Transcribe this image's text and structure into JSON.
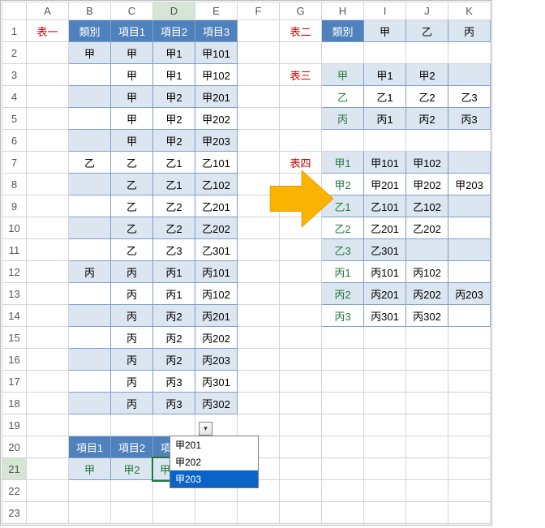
{
  "columns": [
    "A",
    "B",
    "C",
    "D",
    "E",
    "F",
    "G",
    "H",
    "I",
    "J",
    "K"
  ],
  "selectedCol": "D",
  "selectedRow": "21",
  "labels": {
    "t1": "表一",
    "t2": "表二",
    "t3": "表三",
    "t4": "表四"
  },
  "headersT1": {
    "cat": "類別",
    "i1": "項目1",
    "i2": "項目2",
    "i3": "項目3"
  },
  "t1rows": [
    {
      "b": "甲",
      "c": "甲",
      "d": "甲1",
      "e": "甲101",
      "alt": 0
    },
    {
      "b": "",
      "c": "甲",
      "d": "甲1",
      "e": "甲102",
      "alt": 1
    },
    {
      "b": "",
      "c": "甲",
      "d": "甲2",
      "e": "甲201",
      "alt": 0
    },
    {
      "b": "",
      "c": "甲",
      "d": "甲2",
      "e": "甲202",
      "alt": 1
    },
    {
      "b": "",
      "c": "甲",
      "d": "甲2",
      "e": "甲203",
      "alt": 0
    },
    {
      "b": "乙",
      "c": "乙",
      "d": "乙1",
      "e": "乙101",
      "alt": 1
    },
    {
      "b": "",
      "c": "乙",
      "d": "乙1",
      "e": "乙102",
      "alt": 0
    },
    {
      "b": "",
      "c": "乙",
      "d": "乙2",
      "e": "乙201",
      "alt": 1
    },
    {
      "b": "",
      "c": "乙",
      "d": "乙2",
      "e": "乙202",
      "alt": 0
    },
    {
      "b": "",
      "c": "乙",
      "d": "乙3",
      "e": "乙301",
      "alt": 1
    },
    {
      "b": "丙",
      "c": "丙",
      "d": "丙1",
      "e": "丙101",
      "alt": 0
    },
    {
      "b": "",
      "c": "丙",
      "d": "丙1",
      "e": "丙102",
      "alt": 1
    },
    {
      "b": "",
      "c": "丙",
      "d": "丙2",
      "e": "丙201",
      "alt": 0
    },
    {
      "b": "",
      "c": "丙",
      "d": "丙2",
      "e": "丙202",
      "alt": 1
    },
    {
      "b": "",
      "c": "丙",
      "d": "丙2",
      "e": "丙203",
      "alt": 0
    },
    {
      "b": "",
      "c": "丙",
      "d": "丙3",
      "e": "丙301",
      "alt": 1
    },
    {
      "b": "",
      "c": "丙",
      "d": "丙3",
      "e": "丙302",
      "alt": 0
    }
  ],
  "t2": {
    "cat": "類別",
    "c1": "甲",
    "c2": "乙",
    "c3": "丙"
  },
  "t3rows": [
    {
      "h": "甲",
      "i": "甲1",
      "j": "甲2",
      "k": "",
      "alt": 0
    },
    {
      "h": "乙",
      "i": "乙1",
      "j": "乙2",
      "k": "乙3",
      "alt": 1
    },
    {
      "h": "丙",
      "i": "丙1",
      "j": "丙2",
      "k": "丙3",
      "alt": 0
    }
  ],
  "t4rows": [
    {
      "h": "甲1",
      "i": "甲101",
      "j": "甲102",
      "k": "",
      "alt": 0
    },
    {
      "h": "甲2",
      "i": "甲201",
      "j": "甲202",
      "k": "甲203",
      "alt": 1
    },
    {
      "h": "乙1",
      "i": "乙101",
      "j": "乙102",
      "k": "",
      "alt": 0
    },
    {
      "h": "乙2",
      "i": "乙201",
      "j": "乙202",
      "k": "",
      "alt": 1
    },
    {
      "h": "乙3",
      "i": "乙301",
      "j": "",
      "k": "",
      "alt": 0
    },
    {
      "h": "丙1",
      "i": "丙101",
      "j": "丙102",
      "k": "",
      "alt": 1
    },
    {
      "h": "丙2",
      "i": "丙201",
      "j": "丙202",
      "k": "丙203",
      "alt": 0
    },
    {
      "h": "丙3",
      "i": "丙301",
      "j": "丙302",
      "k": "",
      "alt": 1
    }
  ],
  "bottomHeaders": {
    "i1": "項目1",
    "i2": "項目2",
    "i3": "項目3"
  },
  "bottomVals": {
    "v1": "甲",
    "v2": "甲2",
    "v3": "甲203"
  },
  "dropdown": {
    "options": [
      "甲201",
      "甲202",
      "甲203"
    ],
    "selectedIndex": 2
  }
}
